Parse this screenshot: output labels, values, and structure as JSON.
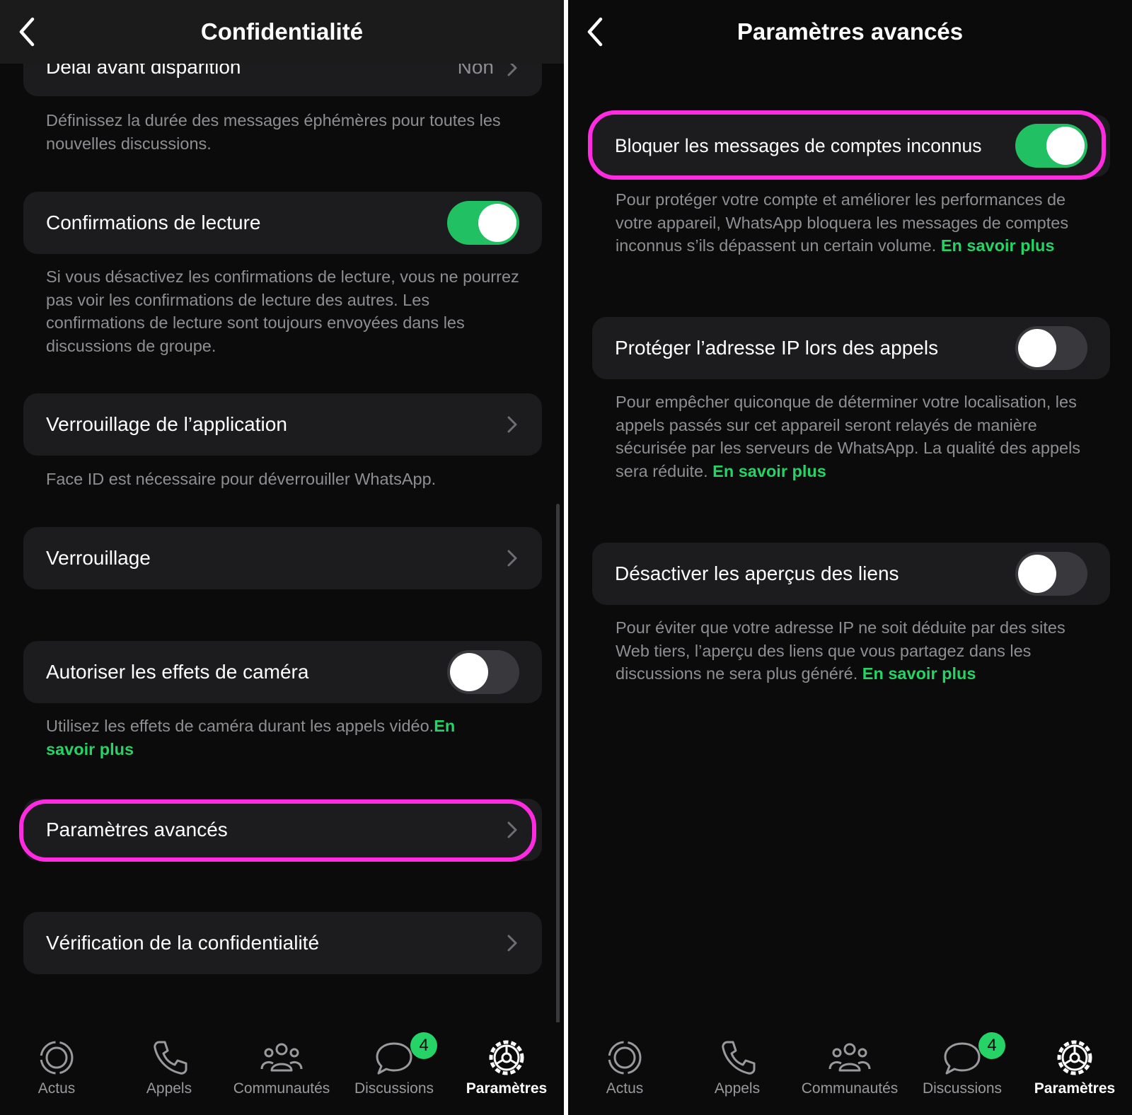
{
  "left": {
    "header": {
      "title": "Confidentialité"
    },
    "disappearing": {
      "label": "Délai avant disparition",
      "value": "Non",
      "description": "Définissez la durée des messages éphémères pour toutes les nouvelles discussions."
    },
    "read_receipts": {
      "label": "Confirmations de lecture",
      "toggle": "on",
      "description": "Si vous désactivez les confirmations de lecture, vous ne pourrez pas voir les confirmations de lecture des autres. Les confirmations de lecture sont toujours envoyées dans les discussions de groupe."
    },
    "app_lock": {
      "label": "Verrouillage de l’application",
      "description": "Face ID est nécessaire pour déverrouiller WhatsApp."
    },
    "lock": {
      "label": "Verrouillage"
    },
    "camera_effects": {
      "label": "Autoriser les effets de caméra",
      "toggle": "off",
      "description": "Utilisez les effets de caméra durant les appels vidéo.",
      "link": "En savoir plus"
    },
    "advanced": {
      "label": "Paramètres avancés"
    },
    "privacy_check": {
      "label": "Vérification de la confidentialité"
    }
  },
  "right": {
    "header": {
      "title": "Paramètres avancés"
    },
    "block_unknown": {
      "label": "Bloquer les messages de comptes inconnus",
      "toggle": "on",
      "description": "Pour protéger votre compte et améliorer les performances de votre appareil, WhatsApp bloquera les messages de comptes inconnus s’ils dépassent un certain volume.",
      "link": "En savoir plus"
    },
    "protect_ip": {
      "label": "Protéger l’adresse IP lors des appels",
      "toggle": "off",
      "description": "Pour empêcher quiconque de déterminer votre localisation, les appels passés sur cet appareil seront relayés de manière sécurisée par les serveurs de WhatsApp. La qualité des appels sera réduite.",
      "link": "En savoir plus"
    },
    "link_previews": {
      "label": "Désactiver les aperçus des liens",
      "toggle": "off",
      "description": "Pour éviter que votre adresse IP ne soit déduite par des sites Web tiers, l’aperçu des liens que vous partagez dans les discussions ne sera plus généré.",
      "link": "En savoir plus"
    }
  },
  "tabbar": {
    "tabs": [
      {
        "label": "Actus",
        "icon": "status-icon"
      },
      {
        "label": "Appels",
        "icon": "phone-icon"
      },
      {
        "label": "Communautés",
        "icon": "communities-icon"
      },
      {
        "label": "Discussions",
        "icon": "chats-icon",
        "badge": "4"
      },
      {
        "label": "Paramètres",
        "icon": "settings-icon",
        "active": true
      }
    ]
  },
  "colors": {
    "accent": "#25d366",
    "toggle_on": "#21c063",
    "highlight": "#ff2be0",
    "background": "#0b0b0b",
    "card": "#1c1c1e",
    "secondary_text": "#8e8e93"
  }
}
